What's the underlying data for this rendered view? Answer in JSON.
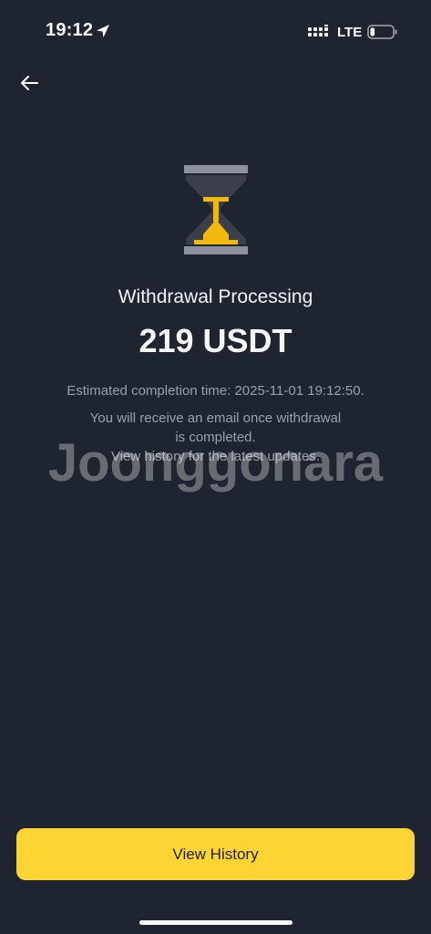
{
  "status_bar": {
    "time": "19:12",
    "network": "LTE",
    "battery_level": 0.2
  },
  "icons": {
    "back": "arrow-left-icon",
    "status": "hourglass-icon"
  },
  "withdrawal": {
    "status_title": "Withdrawal Processing",
    "amount": "219 USDT",
    "estimated_completion": "Estimated completion time: 2025-11-01 19:12:50.",
    "notice_line1": "You will receive an email once withdrawal",
    "notice_line2": "is completed.",
    "notice_line3": "View history for the latest updates."
  },
  "watermark": "Joonggonara",
  "actions": {
    "view_history_label": "View History"
  },
  "colors": {
    "background": "#1f2530",
    "accent": "#fcd535",
    "muted_text": "#9aa0aa"
  }
}
